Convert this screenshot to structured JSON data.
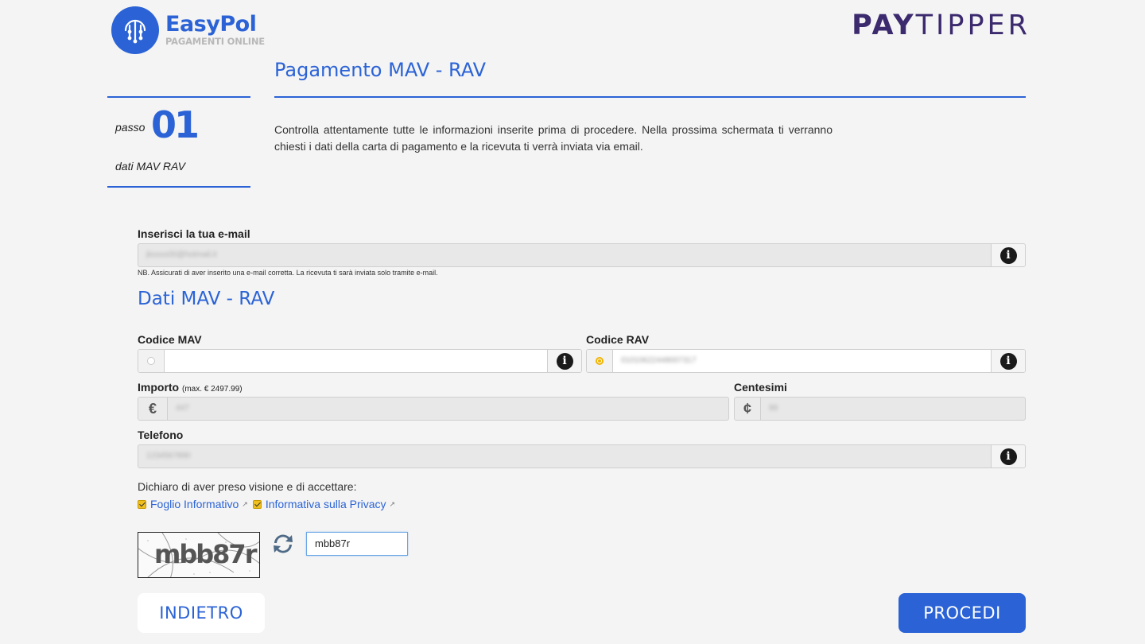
{
  "header": {
    "brand_name": "EasyPol",
    "brand_sub": "PAGAMENTI ONLINE",
    "partner_bold": "PAY",
    "partner_thin": "TIPPER"
  },
  "page_title": "Pagamento MAV - RAV",
  "step": {
    "prefix": "passo",
    "number": "01",
    "label": "dati MAV RAV"
  },
  "intro": "Controlla attentamente tutte le informazioni inserite prima di procedere. Nella prossima schermata ti verranno chiesti i dati della carta di pagamento e la ricevuta ti verrà inviata via email.",
  "form": {
    "email": {
      "label": "Inserisci la tua e-mail",
      "value": "jkxxxx00@hotmail.it",
      "note": "NB. Assicurati di aver inserito una e-mail corretta. La ricevuta ti sarà inviata solo tramite e-mail."
    },
    "section_title": "Dati MAV - RAV",
    "codice_mav": {
      "label": "Codice MAV",
      "value": ""
    },
    "codice_rav": {
      "label": "Codice RAV",
      "value": "01010622448007317"
    },
    "importo": {
      "label": "Importo",
      "hint": "(max. € 2497.99)",
      "prefix": "€",
      "value": "447"
    },
    "centesimi": {
      "label": "Centesimi",
      "prefix": "¢",
      "value": "99"
    },
    "telefono": {
      "label": "Telefono",
      "value": "1234567890"
    },
    "declaration": "Dichiaro di aver preso visione e di accettare:",
    "checkboxes": [
      {
        "label": "Foglio Informativo",
        "checked": true
      },
      {
        "label": "Informativa sulla Privacy",
        "checked": true
      }
    ],
    "captcha": {
      "image_text": "mbb87r",
      "input_value": "mbb87r"
    }
  },
  "buttons": {
    "back": "INDIETRO",
    "next": "PROCEDI"
  },
  "colors": {
    "accent": "#2b63d6",
    "partner": "#3c2a6e",
    "check": "#f0c020"
  }
}
